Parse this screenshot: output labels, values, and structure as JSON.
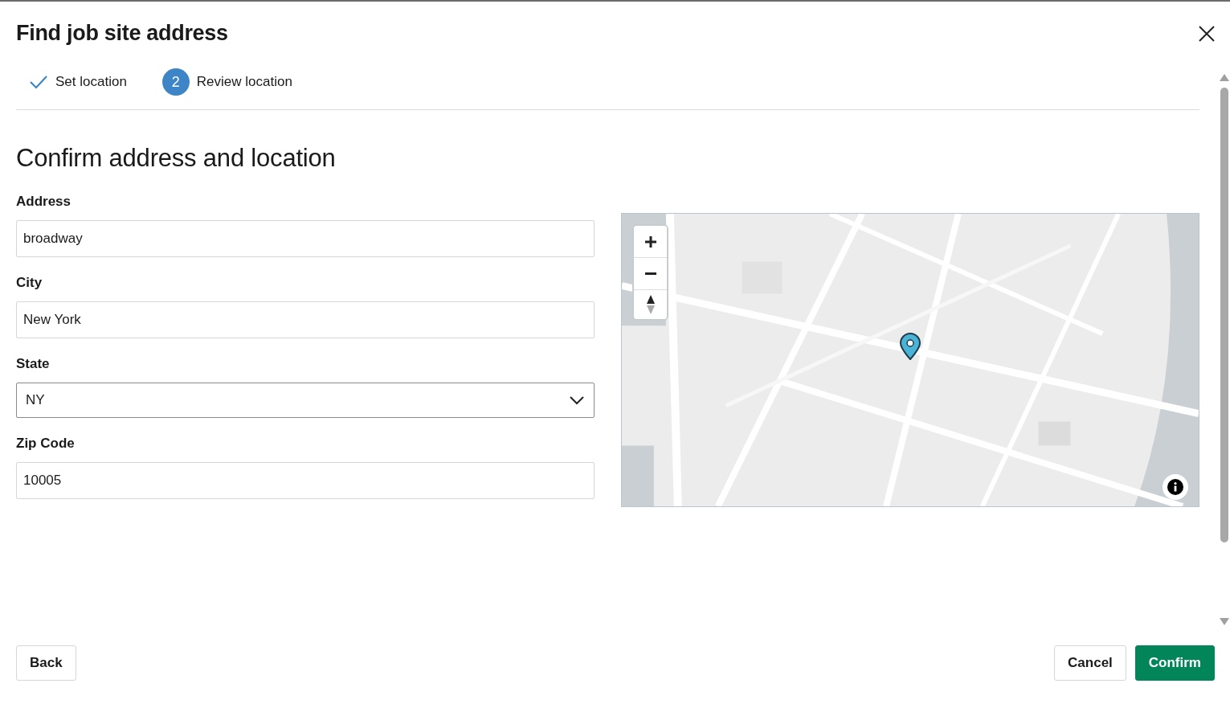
{
  "dialog": {
    "title": "Find job site address"
  },
  "steps": [
    {
      "kind": "done",
      "label": "Set location"
    },
    {
      "kind": "current",
      "number": "2",
      "label": "Review location"
    }
  ],
  "heading": "Confirm address and location",
  "fields": [
    {
      "kind": "text",
      "label": "Address",
      "value": "broadway"
    },
    {
      "kind": "text",
      "label": "City",
      "value": "New York"
    },
    {
      "kind": "select",
      "label": "State",
      "value": "NY"
    },
    {
      "kind": "text",
      "label": "Zip Code",
      "value": "10005"
    }
  ],
  "buttons": {
    "back": "Back",
    "cancel": "Cancel",
    "confirm": "Confirm"
  }
}
